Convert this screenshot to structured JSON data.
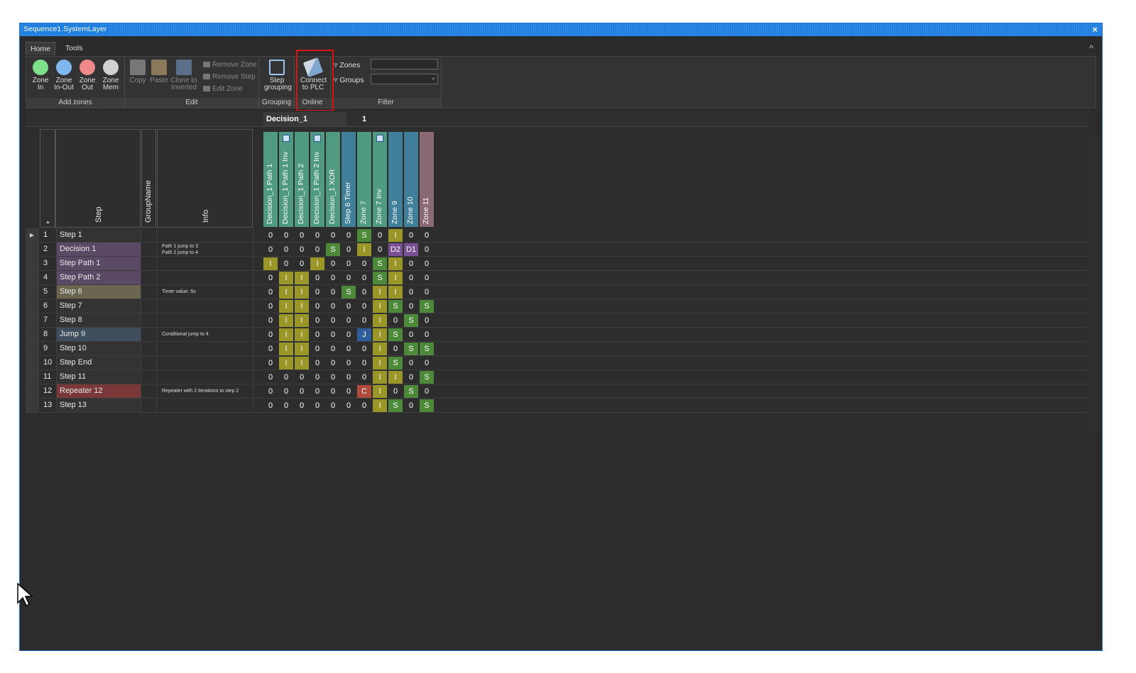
{
  "window": {
    "title": "Sequence1.SystemLayer",
    "close": "×"
  },
  "tabs": [
    "Home",
    "Tools"
  ],
  "collapse": "^",
  "ribbon": {
    "groups": [
      {
        "label": "Add zones"
      },
      {
        "label": "Edit"
      },
      {
        "label": "Grouping"
      },
      {
        "label": "Online"
      },
      {
        "label": "Filter"
      }
    ],
    "add_zones": [
      {
        "line1": "Zone",
        "line2": "In",
        "color": "#7ee08a"
      },
      {
        "line1": "Zone",
        "line2": "In-Out",
        "color": "#7fb8f0"
      },
      {
        "line1": "Zone",
        "line2": "Out",
        "color": "#f08a8a"
      },
      {
        "line1": "Zone",
        "line2": "Mem",
        "color": "#d0d0d0"
      }
    ],
    "edit": {
      "copy": "Copy",
      "paste": "Paste",
      "clone1": "Clone to",
      "clone2": "Inverted",
      "remove_zone": "Remove Zone",
      "remove_step": "Remove Step",
      "edit_zone": "Edit Zone"
    },
    "grouping": {
      "line1": "Step",
      "line2": "grouping"
    },
    "online": {
      "line1": "Connect",
      "line2": "to PLC"
    },
    "filter": {
      "zones": "Zones",
      "groups": "Groups"
    }
  },
  "grid": {
    "banner": "Decision_1",
    "banner2": "1",
    "headers": {
      "step": "Step",
      "group": "GroupName",
      "info": "Info"
    },
    "zones": [
      {
        "name": "Decision_1 Path 1",
        "color": "#4f9a80",
        "inv": false
      },
      {
        "name": "Decision_1 Path 1 Inv",
        "color": "#4f9a80",
        "inv": true
      },
      {
        "name": "Decision_1 Path 2",
        "color": "#4f9a80",
        "inv": false
      },
      {
        "name": "Decision_1 Path 2 Inv",
        "color": "#4f9a80",
        "inv": true
      },
      {
        "name": "Decision_1 XOR",
        "color": "#4f9a80",
        "inv": false
      },
      {
        "name": "Step 6 Timer",
        "color": "#3f7f9a",
        "inv": false
      },
      {
        "name": "Zone 7",
        "color": "#4f9a80",
        "inv": false
      },
      {
        "name": "Zone 7 Inv",
        "color": "#4f9a80",
        "inv": true
      },
      {
        "name": "Zone 9",
        "color": "#3f7f9a",
        "inv": false
      },
      {
        "name": "Zone 10",
        "color": "#3f7f9a",
        "inv": false
      },
      {
        "name": "Zone 11",
        "color": "#8a6a72",
        "inv": false
      }
    ],
    "rows": [
      {
        "num": "1",
        "step": "Step 1",
        "color": "#333333",
        "info": [],
        "cells": [
          "0",
          "0",
          "0",
          "0",
          "0",
          "0",
          "S",
          "0",
          "I",
          "0",
          "0"
        ]
      },
      {
        "num": "2",
        "step": "Decision 1",
        "color": "#5a4a66",
        "info": [
          "Path 1 jump to 3",
          "Path 2 jump to 4"
        ],
        "cells": [
          "0",
          "0",
          "0",
          "0",
          "S",
          "0",
          "I",
          "0",
          "D2",
          "D1",
          "0"
        ]
      },
      {
        "num": "3",
        "step": "Step Path 1",
        "color": "#5a4a66",
        "info": [],
        "cells": [
          "I",
          "0",
          "0",
          "I",
          "0",
          "0",
          "0",
          "S",
          "I",
          "0",
          "0"
        ]
      },
      {
        "num": "4",
        "step": "Step Path 2",
        "color": "#5a4a66",
        "info": [],
        "cells": [
          "0",
          "I",
          "I",
          "0",
          "0",
          "0",
          "0",
          "S",
          "I",
          "0",
          "0"
        ]
      },
      {
        "num": "5",
        "step": "Step 6",
        "color": "#6a6650",
        "info": [
          "Timer value: 5s"
        ],
        "cells": [
          "0",
          "I",
          "I",
          "0",
          "0",
          "S",
          "0",
          "I",
          "I",
          "0",
          "0"
        ]
      },
      {
        "num": "6",
        "step": "Step 7",
        "color": "#333333",
        "info": [],
        "cells": [
          "0",
          "I",
          "I",
          "0",
          "0",
          "0",
          "0",
          "I",
          "S",
          "0",
          "S"
        ]
      },
      {
        "num": "7",
        "step": "Step 8",
        "color": "#333333",
        "info": [],
        "cells": [
          "0",
          "I",
          "I",
          "0",
          "0",
          "0",
          "0",
          "I",
          "0",
          "S",
          "0"
        ]
      },
      {
        "num": "8",
        "step": "Jump 9",
        "color": "#3e4e5c",
        "info": [
          "Conditional jump to 4"
        ],
        "cells": [
          "0",
          "I",
          "I",
          "0",
          "0",
          "0",
          "J",
          "I",
          "S",
          "0",
          "0"
        ]
      },
      {
        "num": "9",
        "step": "Step 10",
        "color": "#333333",
        "info": [],
        "cells": [
          "0",
          "I",
          "I",
          "0",
          "0",
          "0",
          "0",
          "I",
          "0",
          "S",
          "S"
        ]
      },
      {
        "num": "10",
        "step": "Step End",
        "color": "#333333",
        "info": [],
        "cells": [
          "0",
          "I",
          "I",
          "0",
          "0",
          "0",
          "0",
          "I",
          "S",
          "0",
          "0"
        ]
      },
      {
        "num": "11",
        "step": "Step 11",
        "color": "#333333",
        "info": [],
        "cells": [
          "0",
          "0",
          "0",
          "0",
          "0",
          "0",
          "0",
          "I",
          "I",
          "0",
          "S"
        ]
      },
      {
        "num": "12",
        "step": "Repeater 12",
        "color": "#7a3838",
        "info": [
          "Repeater with 2 iterations to step 2"
        ],
        "cells": [
          "0",
          "0",
          "0",
          "0",
          "0",
          "0",
          "C",
          "I",
          "0",
          "S",
          "0"
        ]
      },
      {
        "num": "13",
        "step": "Step 13",
        "color": "#333333",
        "info": [],
        "cells": [
          "0",
          "0",
          "0",
          "0",
          "0",
          "0",
          "0",
          "I",
          "S",
          "0",
          "S"
        ]
      }
    ],
    "cell_colors": {
      "0": "transparent",
      "S": "#4c8a3a",
      "I": "#9a9628",
      "J": "#2f5f9a",
      "C": "#b04a3a",
      "D1": "#7a4f96",
      "D2": "#7a4f96"
    }
  }
}
